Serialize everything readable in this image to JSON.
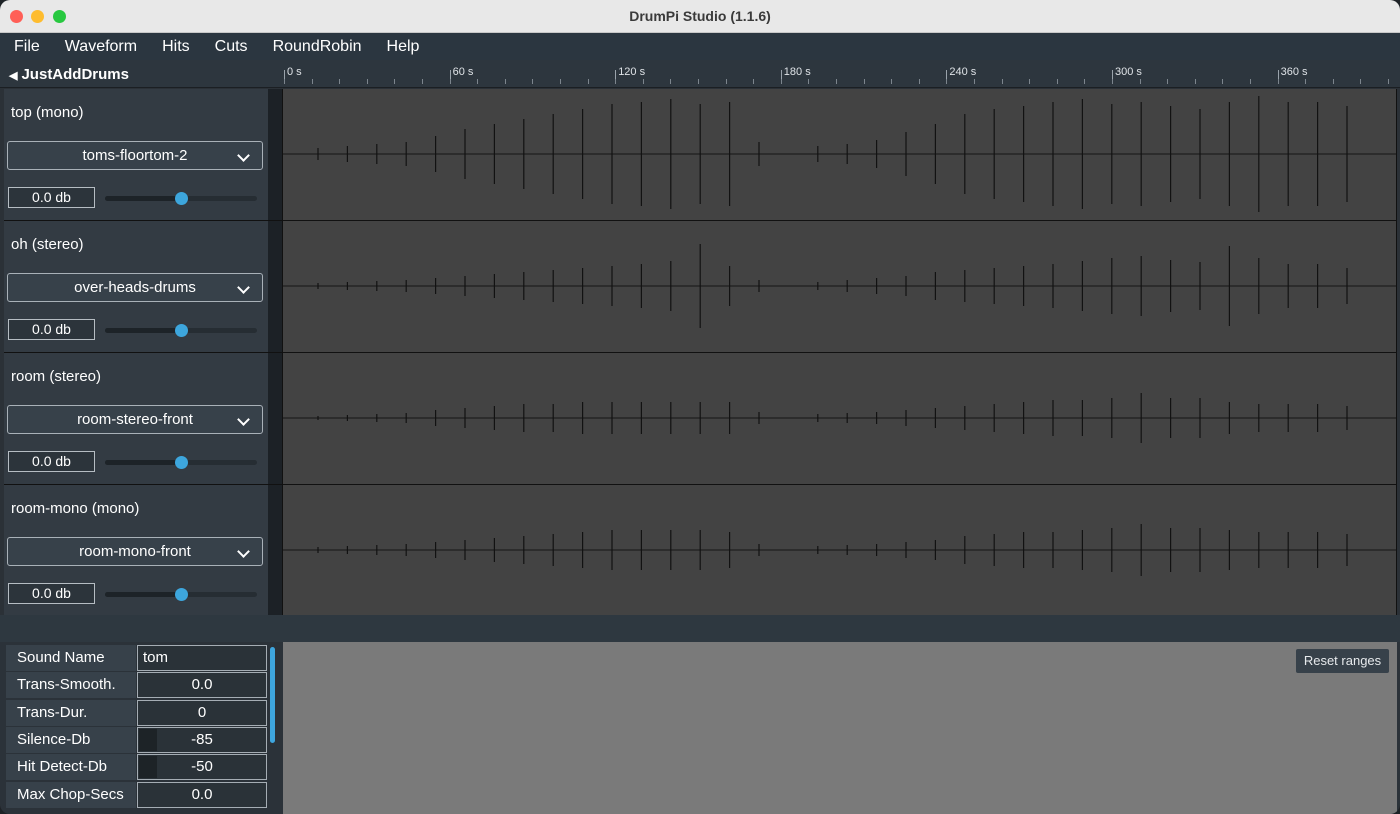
{
  "window": {
    "title": "DrumPi Studio (1.1.6)"
  },
  "menu": {
    "items": [
      "File",
      "Waveform",
      "Hits",
      "Cuts",
      "RoundRobin",
      "Help"
    ]
  },
  "project": {
    "name": "JustAddDrums"
  },
  "ruler": {
    "labels": [
      "0 s",
      "60 s",
      "120 s",
      "180 s",
      "240 s",
      "300 s",
      "360 s"
    ]
  },
  "tracks": [
    {
      "name": "top (mono)",
      "preset": "toms-floortom-2",
      "gain": "0.0 db",
      "slider_level": 0.5
    },
    {
      "name": "oh (stereo)",
      "preset": "over-heads-drums",
      "gain": "0.0 db",
      "slider_level": 0.5
    },
    {
      "name": "room (stereo)",
      "preset": "room-stereo-front",
      "gain": "0.0 db",
      "slider_level": 0.5
    },
    {
      "name": "room-mono (mono)",
      "preset": "room-mono-front",
      "gain": "0.0 db",
      "slider_level": 0.5
    }
  ],
  "params": [
    {
      "label": "Sound Name",
      "value": "tom",
      "align": "left"
    },
    {
      "label": "Trans-Smooth.",
      "value": "0.0"
    },
    {
      "label": "Trans-Dur.",
      "value": "0"
    },
    {
      "label": "Silence-Db",
      "value": "-85",
      "bar": true
    },
    {
      "label": "Hit Detect-Db",
      "value": "-50",
      "bar": true
    },
    {
      "label": "Max Chop-Secs",
      "value": "0.0"
    }
  ],
  "preview": {
    "reset_label": "Reset ranges"
  },
  "colors": {
    "accent": "#3da6dd",
    "panel": "#333b43",
    "waveform_bg": "#434343",
    "preview_bg": "#7a7a7a"
  }
}
